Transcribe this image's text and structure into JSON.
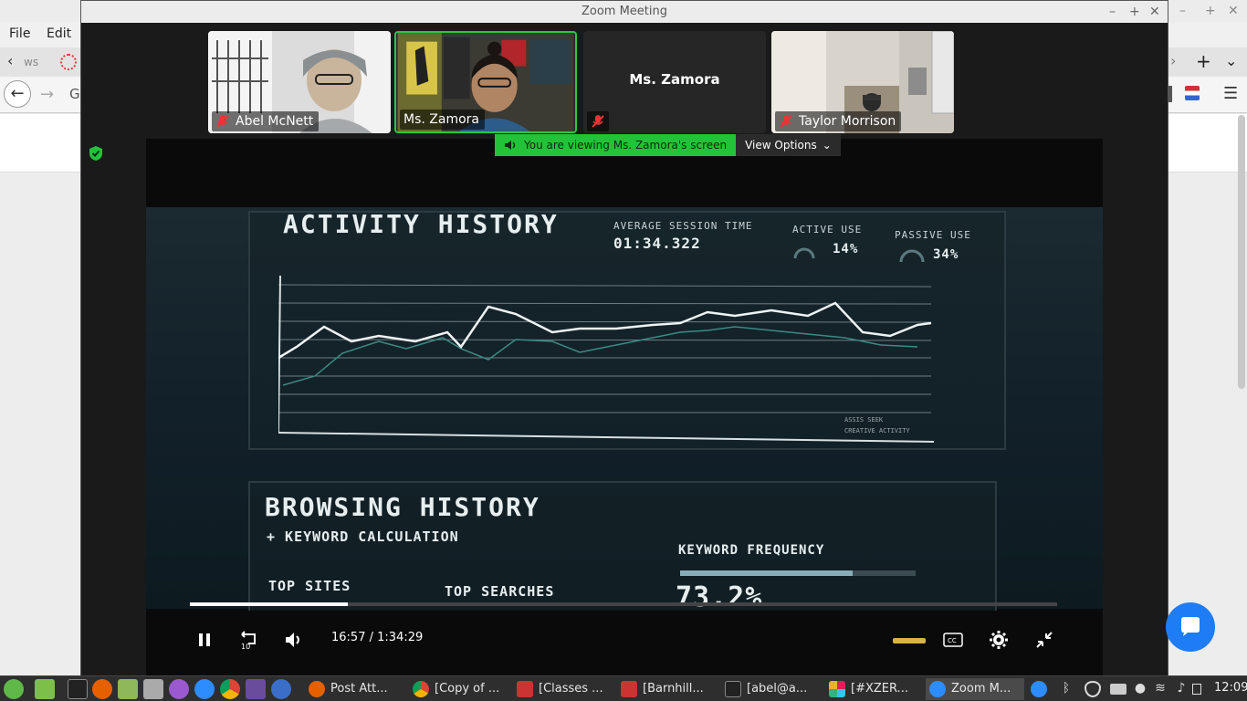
{
  "browser": {
    "menu": [
      "File",
      "Edit"
    ],
    "tab_fragment": "ws"
  },
  "zoom": {
    "title": "Zoom Meeting",
    "participants": [
      {
        "name": "Abel McNett",
        "muted": true,
        "video": true
      },
      {
        "name": "Ms. Zamora",
        "muted": false,
        "video": true,
        "active_speaker": true
      },
      {
        "name": "Ms. Zamora",
        "muted": true,
        "video": false
      },
      {
        "name": "Taylor Morrison",
        "muted": true,
        "video": true
      }
    ],
    "banner_text": "You are viewing Ms. Zamora's screen",
    "view_options_label": "View Options",
    "accent_color": "#23c339"
  },
  "shared_video": {
    "activity_title": "ACTIVITY HISTORY",
    "avg_session_label": "AVERAGE SESSION TIME",
    "avg_session_value": "01:34.322",
    "active_use_label": "ACTIVE USE",
    "active_use_value": "14%",
    "passive_use_label": "PASSIVE USE",
    "passive_use_value": "34%",
    "chart_legend": [
      "ASSIS SEEK",
      "CREATIVE ACTIVITY"
    ],
    "browsing_title": "BROWSING HISTORY",
    "browsing_sub": "+ KEYWORD CALCULATION",
    "keyword_freq_label": "KEYWORD FREQUENCY",
    "keyword_freq_value": "73.2%",
    "top_sites_label": "TOP SITES",
    "top_searches_label": "TOP SEARCHES",
    "player": {
      "current_time": "16:57",
      "separator": "/",
      "duration": "1:34:29",
      "progress_fraction": 0.182,
      "skip_back_label": "10"
    }
  },
  "taskbar": {
    "windows": [
      {
        "label": "Post Att...",
        "icon": "firefox-icon"
      },
      {
        "label": "[Copy of ...",
        "icon": "chrome-icon"
      },
      {
        "label": "[Classes ...",
        "icon": "app-icon"
      },
      {
        "label": "[Barnhill...",
        "icon": "app-icon"
      },
      {
        "label": "[abel@a...",
        "icon": "terminal-icon"
      },
      {
        "label": "[#XZER...",
        "icon": "slack-icon"
      },
      {
        "label": "Zoom M...",
        "icon": "zoom-icon",
        "active": true
      }
    ],
    "clock": "12:09"
  }
}
